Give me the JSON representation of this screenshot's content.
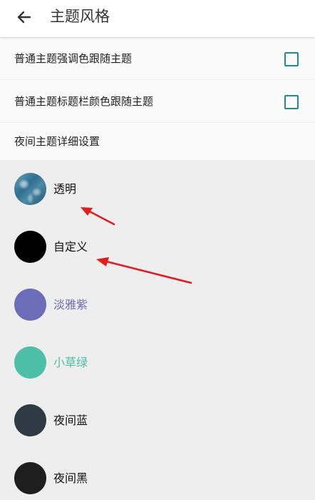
{
  "header": {
    "title": "主题风格",
    "back_icon": "arrow-left-icon"
  },
  "settings": {
    "items": [
      {
        "label": "普通主题强调色跟随主题",
        "checked": false
      },
      {
        "label": "普通主题标题栏颜色跟随主题",
        "checked": false
      },
      {
        "label": "夜间主题详细设置"
      }
    ],
    "checkbox_color": "#1b8f8c"
  },
  "themes": {
    "items": [
      {
        "label": "透明",
        "swatch": "ocean-image",
        "label_color": "#111111"
      },
      {
        "label": "自定义",
        "swatch_color": "#000000",
        "label_color": "#111111"
      },
      {
        "label": "淡雅紫",
        "swatch_color": "#6b6db8",
        "label_color": "#6b6db8"
      },
      {
        "label": "小草绿",
        "swatch_color": "#4dbfa8",
        "label_color": "#4dbfa8"
      },
      {
        "label": "夜间蓝",
        "swatch_color": "#2e3a44",
        "label_color": "#111111"
      },
      {
        "label": "夜间黑",
        "swatch_color": "#1e1e1e",
        "label_color": "#111111"
      }
    ]
  },
  "annotation": {
    "arrow_color": "#e01e1e"
  }
}
